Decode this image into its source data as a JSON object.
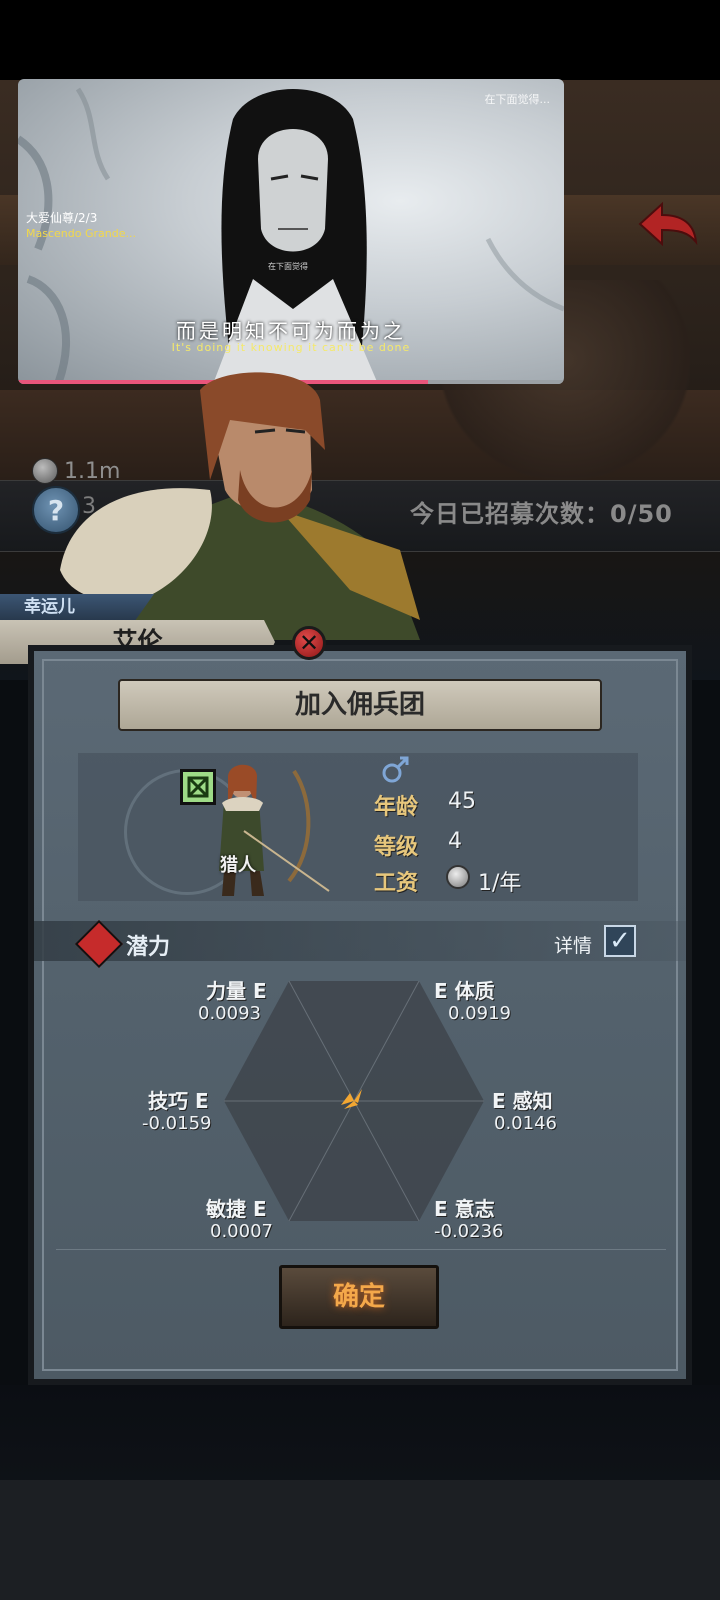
{
  "scene": {
    "coins": "1.1m",
    "help_count": "3",
    "recruit_count": "今日已招募次数：0/50"
  },
  "video": {
    "corner_text": "在下面觉得...",
    "series_title": "大爱仙尊/2/3",
    "series_sub": "Mascendo Grande...",
    "small_caption": "在下面觉得",
    "subtitle_cn": "而是明知不可为而为之",
    "subtitle_en": "It's doing it knowing it can't be done",
    "progress": 0.75
  },
  "character": {
    "title": "幸运儿",
    "name": "艾伦",
    "class": "猎人",
    "gender": "male",
    "stats": [
      {
        "key": "年龄",
        "value": "45"
      },
      {
        "key": "等级",
        "value": "4"
      },
      {
        "key": "工资",
        "value": "1/年"
      }
    ]
  },
  "panel": {
    "header": "加入佣兵团",
    "potential_label": "潜力",
    "detail_label": "详情",
    "detail_checked": true,
    "confirm_label": "确定"
  },
  "attributes": {
    "strength": {
      "name": "力量",
      "grade": "E",
      "value": "0.0093"
    },
    "constitution": {
      "name": "体质",
      "grade": "E",
      "value": "0.0919"
    },
    "skill": {
      "name": "技巧",
      "grade": "E",
      "value": "-0.0159"
    },
    "perception": {
      "name": "感知",
      "grade": "E",
      "value": "0.0146"
    },
    "agility": {
      "name": "敏捷",
      "grade": "E",
      "value": "0.0007"
    },
    "willpower": {
      "name": "意志",
      "grade": "E",
      "value": "-0.0236"
    }
  },
  "colors": {
    "accent_red": "#c62b2b",
    "stat_key": "#e7c77c",
    "confirm_text": "#f4a84a",
    "video_progress": "#e8557b"
  }
}
